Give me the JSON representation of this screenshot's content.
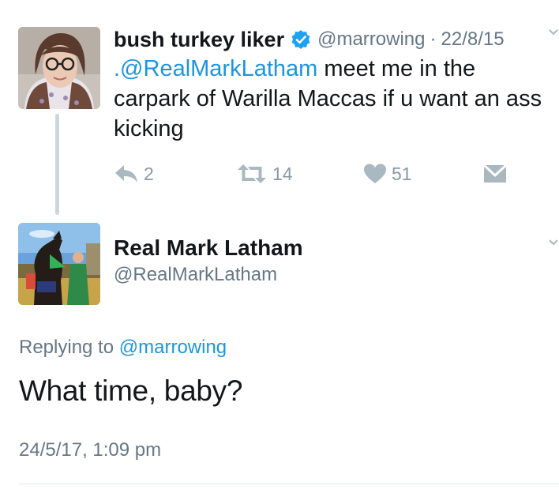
{
  "parent_tweet": {
    "display_name": "bush turkey liker",
    "handle": "@marrowing",
    "separator": "·",
    "time": "22/8/15",
    "text_mention": ".@RealMarkLatham",
    "text_rest": " meet me in the carpark of Warilla Maccas if u want an ass kicking",
    "actions": {
      "reply_count": "2",
      "retweet_count": "14",
      "like_count": "51"
    }
  },
  "reply_tweet": {
    "display_name": "Real Mark Latham",
    "handle": "@RealMarkLatham",
    "replying_prefix": "Replying to ",
    "replying_to": "@marrowing",
    "text": "What time, baby?",
    "timestamp": "24/5/17, 1:09 pm"
  },
  "icons": {
    "verified": "verified-badge-icon",
    "reply": "reply-icon",
    "retweet": "retweet-icon",
    "like": "heart-icon",
    "dm": "envelope-icon",
    "caret": "chevron-down-icon"
  },
  "colors": {
    "link": "#1b95e0",
    "secondary_text": "#657786",
    "action_icon": "#aab8c2",
    "thread_line": "#ccd6dd"
  }
}
